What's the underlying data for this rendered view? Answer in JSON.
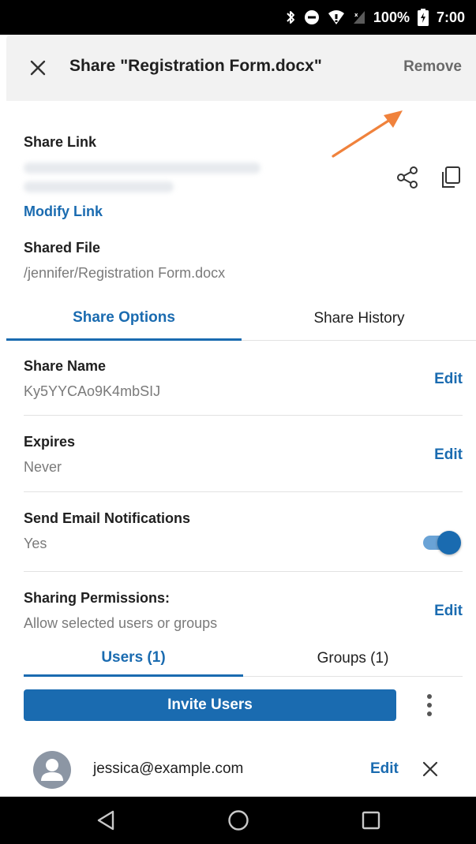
{
  "status_bar": {
    "battery": "100%",
    "time": "7:00",
    "icons": [
      "bluetooth-icon",
      "do-not-disturb-icon",
      "wifi-icon",
      "signal-icon",
      "battery-icon"
    ]
  },
  "app_bar": {
    "title": "Share \"Registration Form.docx\"",
    "remove_label": "Remove",
    "close_icon": "close-icon"
  },
  "share_link": {
    "label": "Share Link",
    "modify_label": "Modify Link",
    "share_icon": "share-icon",
    "copy_icon": "copy-icon"
  },
  "shared_file": {
    "label": "Shared File",
    "path": "/jennifer/Registration Form.docx"
  },
  "tabs": [
    {
      "label": "Share Options",
      "active": true
    },
    {
      "label": "Share History",
      "active": false
    }
  ],
  "options": {
    "share_name": {
      "label": "Share Name",
      "value": "Ky5YYCAo9K4mbSIJ",
      "edit": "Edit"
    },
    "expires": {
      "label": "Expires",
      "value": "Never",
      "edit": "Edit"
    },
    "email_notifications": {
      "label": "Send Email Notifications",
      "value": "Yes",
      "enabled": true
    },
    "permissions": {
      "label": "Sharing Permissions:",
      "value": "Allow selected users or groups",
      "edit": "Edit"
    }
  },
  "sub_tabs": [
    {
      "label": "Users (1)",
      "active": true
    },
    {
      "label": "Groups (1)",
      "active": false
    }
  ],
  "invite_button": "Invite Users",
  "users": [
    {
      "email": "jessica@example.com",
      "edit": "Edit"
    }
  ],
  "colors": {
    "accent": "#1a6bb0",
    "annotation_arrow": "#f0823c"
  }
}
